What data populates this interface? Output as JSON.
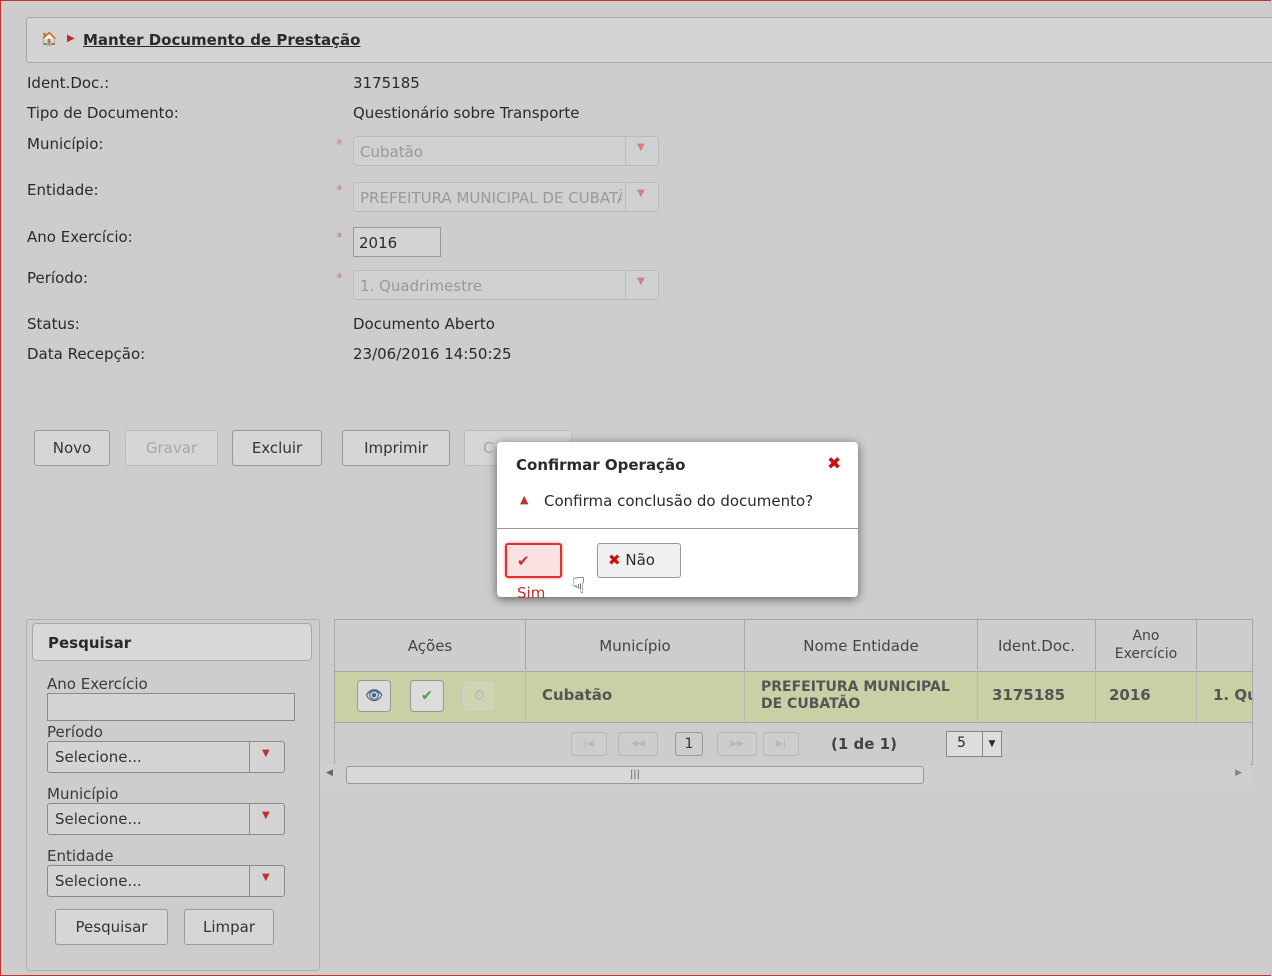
{
  "breadcrumb": {
    "title": "Manter Documento de Prestação"
  },
  "form": {
    "ident_label": "Ident.Doc.:",
    "ident_value": "3175185",
    "tipo_label": "Tipo de Documento:",
    "tipo_value": "Questionário sobre Transporte",
    "municipio_label": "Município:",
    "municipio_value": "Cubatão",
    "entidade_label": "Entidade:",
    "entidade_value": "PREFEITURA MUNICIPAL DE CUBATÃO",
    "ano_label": "Ano Exercício:",
    "ano_value": "2016",
    "periodo_label": "Período:",
    "periodo_value": "1. Quadrimestre",
    "status_label": "Status:",
    "status_value": "Documento Aberto",
    "data_label": "Data Recepção:",
    "data_value": "23/06/2016 14:50:25",
    "required_mark": "*"
  },
  "actions": {
    "novo": "Novo",
    "gravar": "Gravar",
    "excluir": "Excluir",
    "imprimir": "Imprimir",
    "concluir_partial": "C"
  },
  "dialog": {
    "title": "Confirmar Operação",
    "message": "Confirma conclusão do documento?",
    "sim": "Sim",
    "nao": "Não"
  },
  "search": {
    "header": "Pesquisar",
    "ano_label": "Ano Exercício",
    "periodo_label": "Período",
    "periodo_value": "Selecione...",
    "municipio_label": "Município",
    "municipio_value": "Selecione...",
    "entidade_label": "Entidade",
    "entidade_value": "Selecione...",
    "pesquisar": "Pesquisar",
    "limpar": "Limpar"
  },
  "table": {
    "headers": {
      "acoes": "Ações",
      "municipio": "Município",
      "nome_entidade": "Nome Entidade",
      "ident_doc": "Ident.Doc.",
      "ano_1": "Ano",
      "ano_2": "Exercício"
    },
    "rows": [
      {
        "municipio": "Cubatão",
        "entidade_1": "PREFEITURA MUNICIPAL",
        "entidade_2": "DE CUBATÃO",
        "ident": "3175185",
        "ano": "2016",
        "periodo": "1. Qu"
      }
    ],
    "pager": {
      "page": "1",
      "summary": "(1 de 1)",
      "per_page": "5"
    }
  }
}
